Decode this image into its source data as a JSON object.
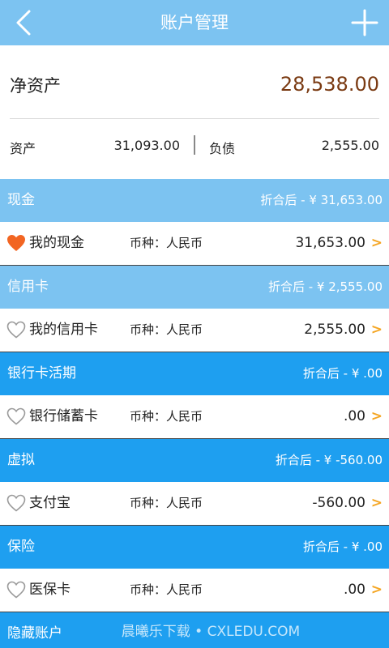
{
  "header": {
    "title": "账户管理",
    "back_icon": "back-arrow-icon",
    "add_icon": "plus-icon"
  },
  "summary": {
    "net_label": "净资产",
    "net_value": "28,538.00",
    "asset_label": "资产",
    "asset_value": "31,093.00",
    "debt_label": "负债",
    "debt_value": "2,555.00"
  },
  "sections": [
    {
      "name": "现金",
      "total": "折合后 - ¥ 31,653.00"
    },
    {
      "name": "信用卡",
      "total": "折合后 - ¥ 2,555.00"
    },
    {
      "name": "银行卡活期",
      "total": "折合后 - ¥ .00"
    },
    {
      "name": "虚拟",
      "total": "折合后 - ¥ -560.00"
    },
    {
      "name": "保险",
      "total": "折合后 - ¥ .00"
    },
    {
      "name": "隐藏账户"
    }
  ],
  "accounts": [
    {
      "name": "我的现金",
      "currency": "币种：人民币",
      "amount": "31,653.00",
      "arrow": ">",
      "favorite": true
    },
    {
      "name": "我的信用卡",
      "currency": "币种：人民币",
      "amount": "2,555.00",
      "arrow": ">",
      "favorite": false
    },
    {
      "name": "银行储蓄卡",
      "currency": "币种：人民币",
      "amount": ".00",
      "arrow": ">",
      "favorite": false
    },
    {
      "name": "支付宝",
      "currency": "币种：人民币",
      "amount": "-560.00",
      "arrow": ">",
      "favorite": false
    },
    {
      "name": "医保卡",
      "currency": "币种：人民币",
      "amount": ".00",
      "arrow": ">",
      "favorite": false
    }
  ],
  "watermark": "晨曦乐下载 • CXLEDU.COM",
  "colors": {
    "header": "#7cc3f1",
    "section_light": "#7cc3f1",
    "section_dark": "#1e9ff0",
    "net_value": "#7a3a12",
    "arrow": "#f5a623",
    "heart_filled": "#f26522"
  }
}
